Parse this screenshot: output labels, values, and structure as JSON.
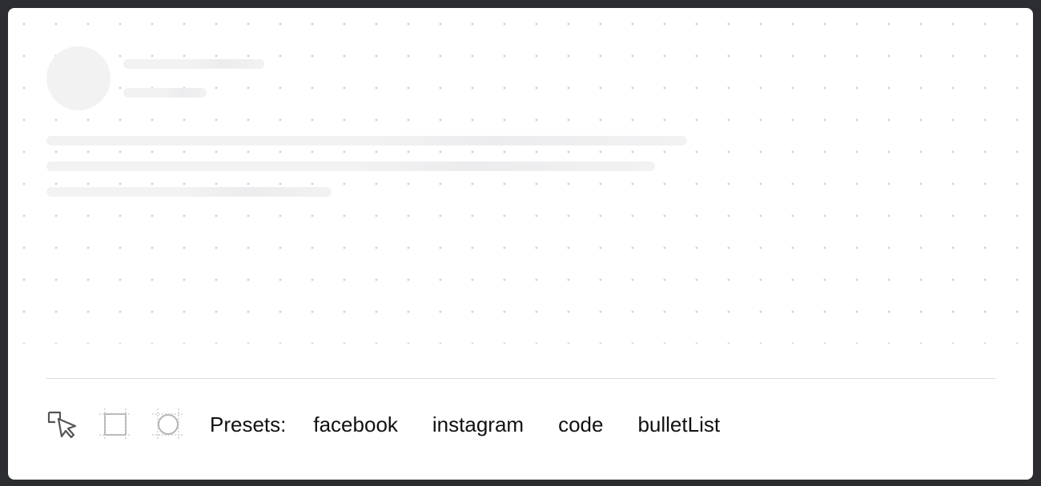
{
  "toolbar": {
    "tools": [
      {
        "name": "select-tool",
        "icon": "cursor-select-icon"
      },
      {
        "name": "rect-tool",
        "icon": "rectangle-icon"
      },
      {
        "name": "circle-tool",
        "icon": "circle-icon"
      }
    ],
    "presets_label": "Presets:",
    "presets": [
      "facebook",
      "instagram",
      "code",
      "bulletList"
    ]
  },
  "colors": {
    "background": "#2b2d31",
    "surface": "#ffffff",
    "skeleton": "#f2f2f3",
    "grid_dot": "#d4d4d8",
    "divider": "#dcdcdf",
    "text": "#111111"
  }
}
